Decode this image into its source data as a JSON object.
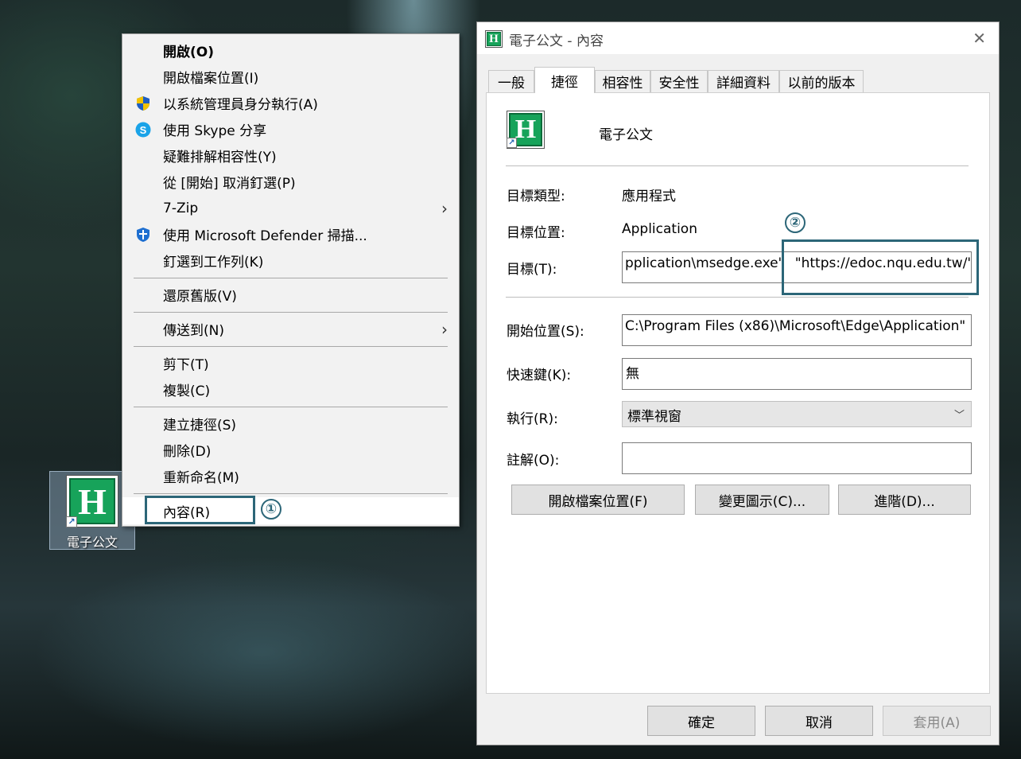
{
  "desktop": {
    "icon_label": "電子公文",
    "icon_glyph": "H"
  },
  "context_menu": {
    "items": [
      {
        "label": "開啟(O)",
        "bold": true
      },
      {
        "label": "開啟檔案位置(I)"
      },
      {
        "label": "以系統管理員身分執行(A)",
        "icon": "uac-shield-icon"
      },
      {
        "label": "使用 Skype 分享",
        "icon": "skype-icon"
      },
      {
        "label": "疑難排解相容性(Y)"
      },
      {
        "label": "從 [開始] 取消釘選(P)"
      },
      {
        "label": "7-Zip",
        "submenu": true
      },
      {
        "label": "使用 Microsoft Defender 掃描...",
        "icon": "defender-shield-icon"
      },
      {
        "label": "釘選到工作列(K)"
      },
      {
        "label": "還原舊版(V)"
      },
      {
        "label": "傳送到(N)",
        "submenu": true
      },
      {
        "label": "剪下(T)"
      },
      {
        "label": "複製(C)"
      },
      {
        "label": "建立捷徑(S)"
      },
      {
        "label": "刪除(D)"
      },
      {
        "label": "重新命名(M)"
      },
      {
        "label": "內容(R)",
        "highlighted": true
      }
    ],
    "submenu_glyph": "›"
  },
  "annotations": {
    "step1": "①",
    "step2": "②",
    "color": "#2c6678"
  },
  "dialog": {
    "title": "電子公文 - 內容",
    "close_glyph": "✕",
    "tabs": [
      "一般",
      "捷徑",
      "相容性",
      "安全性",
      "詳細資料",
      "以前的版本"
    ],
    "active_tab": "捷徑",
    "shortcut_name": "電子公文",
    "target_type_label": "目標類型:",
    "target_type_value": "應用程式",
    "target_location_label": "目標位置:",
    "target_location_value": "Application",
    "target_label": "目標(T):",
    "target_value_left": "pplication\\msedge.exe\"",
    "target_value_right": "\"https://edoc.nqu.edu.tw/\"",
    "start_in_label": "開始位置(S):",
    "start_in_value": "C:\\Program Files (x86)\\Microsoft\\Edge\\Application\"",
    "shortcut_key_label": "快速鍵(K):",
    "shortcut_key_value": "無",
    "run_label": "執行(R):",
    "run_value": "標準視窗",
    "comment_label": "註解(O):",
    "comment_value": "",
    "open_location_button": "開啟檔案位置(F)",
    "change_icon_button": "變更圖示(C)...",
    "advanced_button": "進階(D)...",
    "ok_button": "確定",
    "cancel_button": "取消",
    "apply_button": "套用(A)"
  }
}
